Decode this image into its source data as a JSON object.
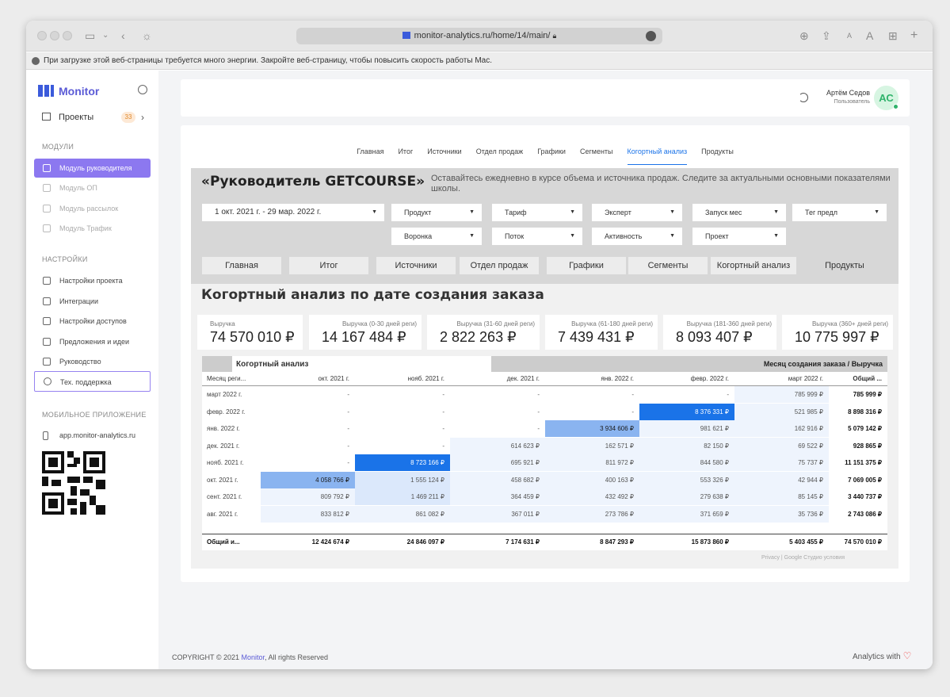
{
  "browser": {
    "url": "monitor-analytics.ru/home/14/main/",
    "icons": [
      "sidebar-toggle-icon",
      "back-icon",
      "brightness-icon",
      "download-icon",
      "share-icon",
      "text-smaller-icon",
      "text-larger-icon",
      "tabs-icon",
      "new-tab-icon"
    ],
    "text_small": "A",
    "text_large": "A",
    "new_tab": "+"
  },
  "warning": "При загрузке этой веб-страницы требуется много энергии. Закройте веб-страницу, чтобы повысить скорость работы Mac.",
  "sidebar": {
    "brand": "Monitor",
    "projects_label": "Проекты",
    "projects_count": "33",
    "modules_header": "МОДУЛИ",
    "modules": [
      {
        "label": "Модуль руководителя"
      },
      {
        "label": "Модуль ОП"
      },
      {
        "label": "Модуль рассылок"
      },
      {
        "label": "Модуль Трафик"
      }
    ],
    "settings_header": "НАСТРОЙКИ",
    "settings": [
      {
        "label": "Настройки проекта"
      },
      {
        "label": "Интеграции"
      },
      {
        "label": "Настройки доступов"
      },
      {
        "label": "Предложения и идеи"
      },
      {
        "label": "Руководство"
      },
      {
        "label": "Тех. поддержка"
      }
    ],
    "mobile_header": "МОБИЛЬНОЕ ПРИЛОЖЕНИЕ",
    "mobile_link": "app.monitor-analytics.ru"
  },
  "user": {
    "name": "Артём Седов",
    "role": "Пользователь",
    "initials": "АС"
  },
  "tabs": [
    "Главная",
    "Итог",
    "Источники",
    "Отдел продаж",
    "Графики",
    "Сегменты",
    "Когортный анализ",
    "Продукты"
  ],
  "active_tab": "Когортный анализ",
  "report": {
    "title": "«Руководитель GETCOURSE»",
    "description": "Оставайтесь ежедневно в курсе объема и источника продаж. Следите за актуальными основными показателями школы.",
    "date_range": "1 окт. 2021 г. - 29 мар. 2022 г.",
    "filters_row1": [
      "Продукт",
      "Тариф",
      "Эксперт",
      "Запуск мес",
      "Тег предл"
    ],
    "filters_row2": [
      "Воронка",
      "Поток",
      "Активность",
      "Проект"
    ],
    "tabs": [
      "Главная",
      "Итог",
      "Источники",
      "Отдел продаж",
      "Графики",
      "Сегменты",
      "Когортный анализ",
      "Продукты"
    ],
    "section_title": "Когортный анализ по дате создания заказа",
    "kpis": [
      {
        "label": "Выручка",
        "value": "74 570 010 ₽"
      },
      {
        "label": "Выручка (0-30 дней реги)",
        "value": "14 167 484 ₽"
      },
      {
        "label": "Выручка (31-60 дней реги)",
        "value": "2 822 263 ₽"
      },
      {
        "label": "Выручка (61-180 дней реги)",
        "value": "7 439 431 ₽"
      },
      {
        "label": "Выручка (181-360 дней реги)",
        "value": "8 093 407 ₽"
      },
      {
        "label": "Выручка (360+ дней реги)",
        "value": "10 775 997 ₽"
      }
    ],
    "table": {
      "title": "Когортный анализ",
      "right_title": "Месяц создания заказа / Выручка",
      "columns": [
        "Месяц реги...",
        "окт. 2021 г.",
        "нояб. 2021 г.",
        "дек. 2021 г.",
        "янв. 2022 г.",
        "февр. 2022 г.",
        "март 2022 г.",
        "Общий ..."
      ],
      "rows": [
        {
          "label": "март 2022 г.",
          "cells": [
            "-",
            "-",
            "-",
            "-",
            "-",
            "785 999 ₽"
          ],
          "total": "785 999 ₽"
        },
        {
          "label": "февр. 2022 г.",
          "cells": [
            "-",
            "-",
            "-",
            "-",
            "8 376 331 ₽",
            "521 985 ₽"
          ],
          "total": "8 898 316 ₽"
        },
        {
          "label": "янв. 2022 г.",
          "cells": [
            "-",
            "-",
            "-",
            "3 934 606 ₽",
            "981 621 ₽",
            "162 916 ₽"
          ],
          "total": "5 079 142 ₽"
        },
        {
          "label": "дек. 2021 г.",
          "cells": [
            "-",
            "-",
            "614 623 ₽",
            "162 571 ₽",
            "82 150 ₽",
            "69 522 ₽"
          ],
          "total": "928 865 ₽"
        },
        {
          "label": "нояб. 2021 г.",
          "cells": [
            "-",
            "8 723 166 ₽",
            "695 921 ₽",
            "811 972 ₽",
            "844 580 ₽",
            "75 737 ₽"
          ],
          "total": "11 151 375 ₽"
        },
        {
          "label": "окт. 2021 г.",
          "cells": [
            "4 058 766 ₽",
            "1 555 124 ₽",
            "458 682 ₽",
            "400 163 ₽",
            "553 326 ₽",
            "42 944 ₽"
          ],
          "total": "7 069 005 ₽"
        },
        {
          "label": "сент. 2021 г.",
          "cells": [
            "809 792 ₽",
            "1 469 211 ₽",
            "364 459 ₽",
            "432 492 ₽",
            "279 638 ₽",
            "85 145 ₽"
          ],
          "total": "3 440 737 ₽"
        },
        {
          "label": "авг. 2021 г.",
          "cells": [
            "833 812 ₽",
            "861 082 ₽",
            "367 011 ₽",
            "273 786 ₽",
            "371 659 ₽",
            "35 736 ₽"
          ],
          "total": "2 743 086 ₽"
        }
      ],
      "total_row": {
        "label": "Общий и...",
        "cells": [
          "12 424 674 ₽",
          "24 846 097 ₽",
          "7 174 631 ₽",
          "8 847 293 ₽",
          "15 873 860 ₽",
          "5 403 455 ₽"
        ],
        "total": "74 570 010 ₽"
      },
      "footnote": "Privacy | Google Студио условия"
    }
  },
  "footer": {
    "copyright_prefix": "COPYRIGHT © 2021 ",
    "copyright_brand": "Monitor",
    "copyright_suffix": ", All rights Reserved",
    "right": "Analytics with"
  },
  "colors": {
    "accent": "#8c78f0",
    "brand": "#5b5bd6",
    "dark_cell": "#1a73e8",
    "mid_cell": "#8ab4f0",
    "light_cell": "#dbe8fb",
    "pale_cell": "#eef4fd"
  }
}
